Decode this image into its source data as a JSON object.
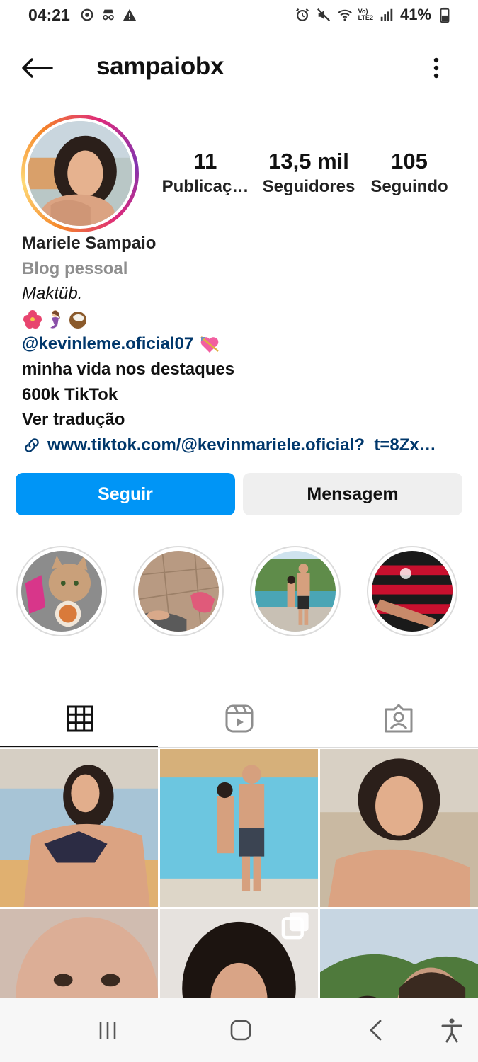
{
  "status_bar": {
    "time": "04:21",
    "battery_percent": "41%",
    "network_label": "LTE2",
    "left_icons": [
      "sync-icon",
      "incognito-icon",
      "warning-icon"
    ],
    "right_icons": [
      "alarm-icon",
      "mute-icon",
      "wifi-icon",
      "signal-icon",
      "battery-icon"
    ]
  },
  "header": {
    "username": "sampaiobx",
    "back_icon": "arrow-left-icon",
    "more_icon": "more-vertical-icon"
  },
  "profile": {
    "stats": [
      {
        "value": "11",
        "label": "Publicaç…"
      },
      {
        "value": "13,5 mil",
        "label": "Seguidores"
      },
      {
        "value": "105",
        "label": "Seguindo"
      }
    ],
    "name": "Mariele Sampaio",
    "category": "Blog pessoal",
    "bio_line1": "Maktüb.",
    "bio_emojis": [
      "hibiscus-emoji",
      "mermaid-emoji",
      "coconut-emoji"
    ],
    "mention": "@kevinleme.oficial07",
    "mention_emoji": "heart-arrow-emoji",
    "bio_line3": "minha vida nos destaques",
    "bio_line4": "600k TikTok",
    "translate": "Ver tradução",
    "link": "www.tiktok.com/@kevinmariele.oficial?_t=8Zx…"
  },
  "buttons": {
    "follow": "Seguir",
    "message": "Mensagem"
  },
  "highlights": [
    "cat",
    "pool-feet",
    "couple-waterpark",
    "flamengo-shirt"
  ],
  "tabs": [
    {
      "name": "posts",
      "icon": "grid-icon",
      "active": true
    },
    {
      "name": "reels",
      "icon": "reels-icon",
      "active": false
    },
    {
      "name": "tagged",
      "icon": "tagged-icon",
      "active": false
    }
  ],
  "colors": {
    "follow_button": "#0095f6",
    "message_button": "#efefef",
    "link": "#00376b",
    "category": "#8e8e8e"
  },
  "navbar": {
    "icons": [
      "recent-apps-icon",
      "home-icon",
      "back-icon",
      "accessibility-icon"
    ]
  }
}
